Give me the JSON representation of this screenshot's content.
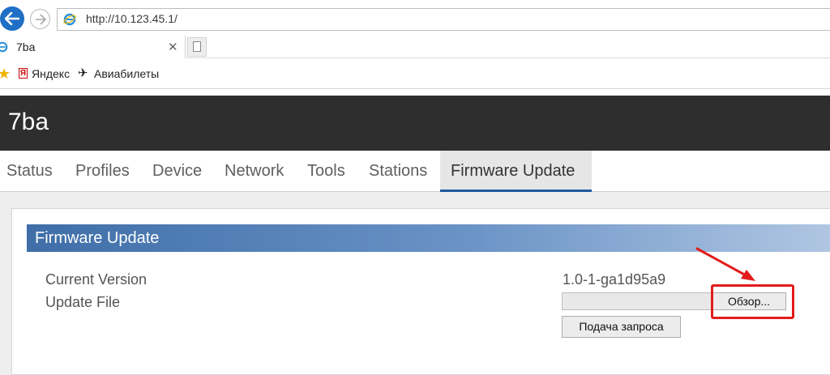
{
  "browser": {
    "url": "http://10.123.45.1/",
    "tab_title": "7ba",
    "tab_close": "✕",
    "favorites": [
      {
        "label": "Яндекс",
        "icon": "yandex-icon"
      },
      {
        "label": "Авиабилеты",
        "icon": "plane-icon"
      }
    ]
  },
  "site": {
    "title": "7ba",
    "nav": [
      "Status",
      "Profiles",
      "Device",
      "Network",
      "Tools",
      "Stations",
      "Firmware Update"
    ],
    "active_nav": "Firmware Update"
  },
  "firmware": {
    "panel_title": "Firmware Update",
    "current_version_label": "Current Version",
    "current_version_value": "1.0-1-ga1d95a9",
    "update_file_label": "Update File",
    "browse_label": "Обзор...",
    "submit_label": "Подача запроса"
  },
  "colors": {
    "header_bg": "#2e2e2e",
    "panel_head_start": "#3f6ea8",
    "panel_head_end": "#b0c6e2",
    "annotation": "#e21b1b",
    "nav_active_underline": "#1f5aa0"
  }
}
